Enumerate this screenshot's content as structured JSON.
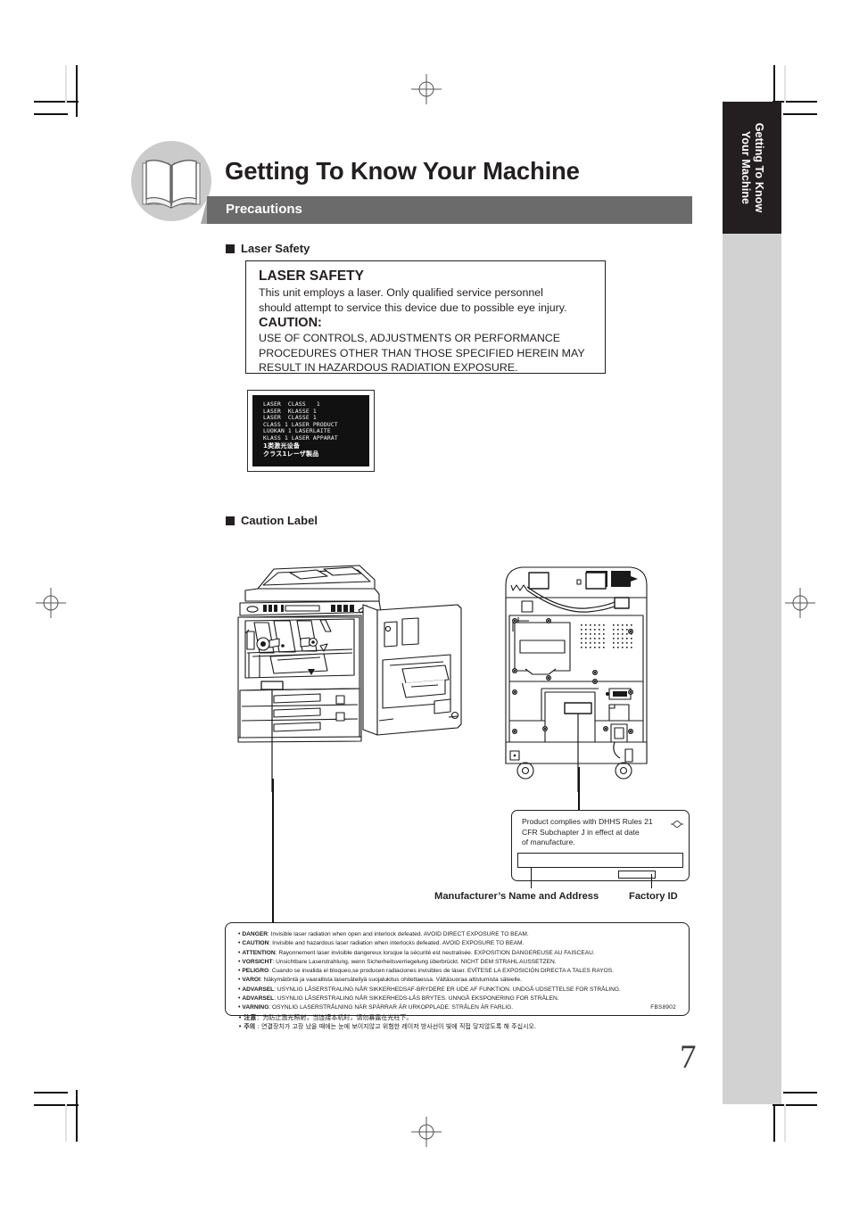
{
  "document": {
    "page_number": "7",
    "side_tab_label": "Getting To Know\nYour Machine",
    "title": "Getting To Know Your Machine",
    "section_bar_label": "Precautions",
    "icon_badge": "open-book-icon"
  },
  "sections": {
    "laser_safety_heading": "Laser Safety",
    "caution_label_heading": "Caution Label"
  },
  "laser_box": {
    "title": "LASER SAFETY",
    "line1": "This unit employs a laser. Only qualified service personnel",
    "line2": "should attempt to service this device due to possible eye injury.",
    "caution_title": "CAUTION:",
    "caution1": "USE OF CONTROLS, ADJUSTMENTS OR PERFORMANCE",
    "caution2": "PROCEDURES OTHER THAN THOSE SPECIFIED HEREIN MAY",
    "caution3": "RESULT IN HAZARDOUS RADIATION EXPOSURE."
  },
  "class_plate": {
    "l1": "LASER  CLASS   1",
    "l2": "LASER  KLASSE 1",
    "l3": "LASER  CLASSE 1",
    "l4": "CLASS 1 LASER PRODUCT",
    "l5": "LUOKAN 1 LASERLAITE",
    "l6": "KLASS 1 LASER APPARAT",
    "l7": "1类激光设备",
    "l8": "クラス1レーザ製品"
  },
  "dhhs_label": {
    "line1": "Product complies with DHHS Rules 21",
    "line2": "CFR Subchapter J in effect at date",
    "line3": "of manufacture.",
    "manufacturer_callout": "Manufacturer’s Name and Address",
    "factory_callout": "Factory ID"
  },
  "warning_label": {
    "part_number": "FBS8902",
    "lines": [
      {
        "lang": "DANGER",
        "text": ": Invisible laser radiation when open and interlock defeated. AVOID DIRECT EXPOSURE TO BEAM."
      },
      {
        "lang": "CAUTION",
        "text": ": Invisible and hazardous laser radiation  when interlocks defeated. AVOID EXPOSURE TO BEAM."
      },
      {
        "lang": "ATTENTION",
        "text": ": Rayonnement laser invisible dangereux lorsque la sécurité est neutralisée. EXPOSITION DANGEREUSE AU FAISCEAU."
      },
      {
        "lang": "VORSICHT",
        "text": ": Unsichtbare Laserstrahlung, wenn Sicherheitsverriegelung überbrückt. NICHT DEM STRAHL AUSSETZEN."
      },
      {
        "lang": "PELIGRO",
        "text": ": Cuando se invalida el bloqueo,se producen radiaciones invisibles de láser. EVÍTESE LA EXPOSICIÓN DIRECTA  A TALES RAYOS."
      },
      {
        "lang": "VAROI",
        "text": ": Näkymätöntä ja vaarallista lasersäteilyä suojalukitus ohitettaessa. Vältäsuoraa altistumista säteelle."
      },
      {
        "lang": "ADVARSEL",
        "text": ": USYNLIG LÅSERSTRALING NÅR SIKKERHEDSAF-BRYDERE ER UDE AF FUNKTION. UNDGÅ UDSETTELSE FOR STRÅLING."
      },
      {
        "lang": "ADVARSEL",
        "text": ": USYNLIG LÅSERSTRALING NÅR SIKKERHEDS-LÅS BRYTES. UNNGÅ EKSPONERING FOR STRÅLEN."
      },
      {
        "lang": "VARNING",
        "text": ": OSYNLIG LASERSTRÅLNING NÄR SPÄRRAR ÄR URKOPPLADE. STRÅLEN ÄR FARLIG."
      },
      {
        "lang": "注意",
        "text": "：为防止激光照射，当连接本机时，请勿暴露在光柱下。"
      },
      {
        "lang": "주의",
        "text": " : 연결장치가 고장 났을 때에는 눈에 보이지않고 위험한 레이저 방사선이 빛에 직접 닿지않도록 해 주십시오."
      }
    ]
  },
  "illustration": {
    "front_view_name": "copier-front-view-door-open",
    "rear_view_name": "copier-rear-view"
  },
  "colors": {
    "bar": "#6b6b6b",
    "tab_dark": "#231f20",
    "tab_grey": "#d2d2d2",
    "ink": "#231f20"
  }
}
